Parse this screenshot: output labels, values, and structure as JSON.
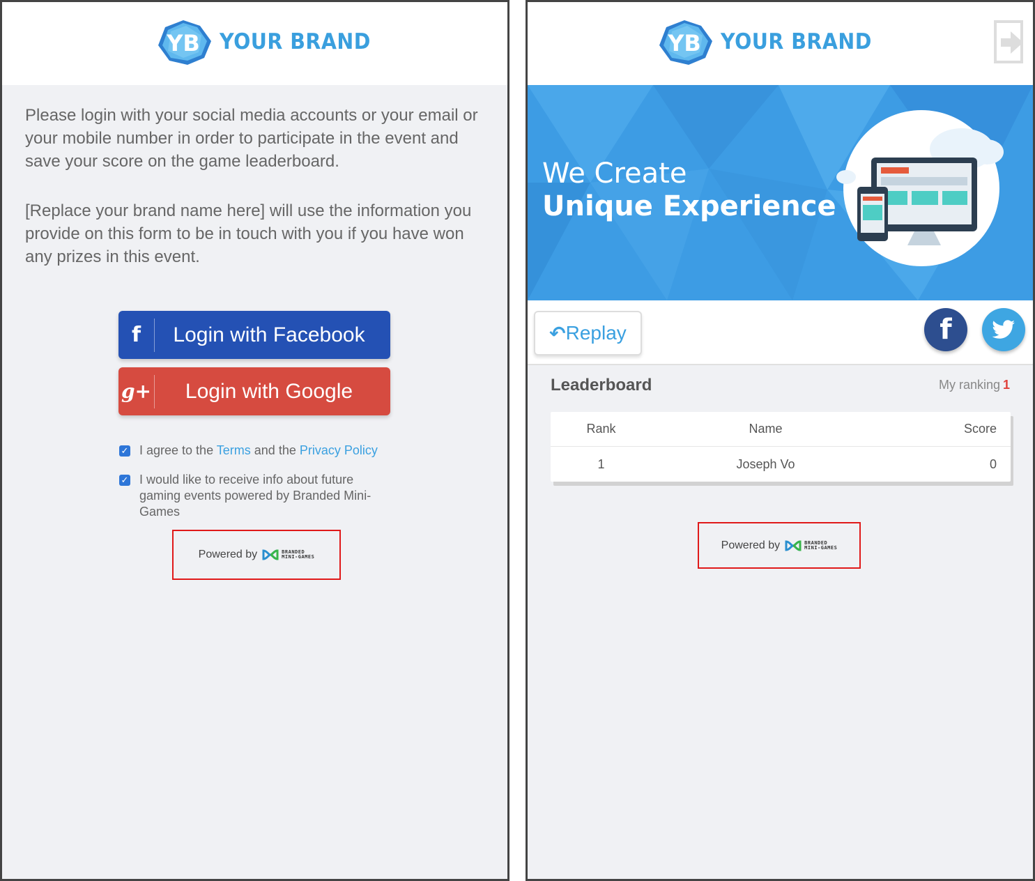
{
  "brand": {
    "initials": "YB",
    "name": "YOUR BRAND"
  },
  "login_screen": {
    "intro_paragraph_1": "Please login with your social media accounts or your email or your mobile number in order to participate in the event and save your score on the game leaderboard.",
    "intro_paragraph_2": "[Replace your brand name here] will use the information you provide on this form to be in touch with you if you have won any prizes in this event.",
    "facebook_button": {
      "icon": "f",
      "label": "Login with Facebook"
    },
    "google_button": {
      "icon": "g+",
      "label": "Login with Google"
    },
    "agree": {
      "checked": true,
      "prefix": "I agree to the",
      "terms_link": "Terms",
      "middle": "and the",
      "privacy_link": "Privacy Policy"
    },
    "info_optin": {
      "checked": true,
      "label": "I would like to receive info about future gaming events powered by Branded Mini-Games"
    },
    "powered_by": {
      "prefix": "Powered by",
      "logo_line1": "BRANDED",
      "logo_line2": "MINI-GAMES"
    }
  },
  "leaderboard_screen": {
    "banner": {
      "line1": "We Create",
      "line2": "Unique Experience"
    },
    "replay_label": "Replay",
    "title": "Leaderboard",
    "my_ranking_label": "My ranking",
    "my_ranking_value": "1",
    "table": {
      "columns": [
        "Rank",
        "Name",
        "Score"
      ],
      "rows": [
        {
          "rank": "1",
          "name": "Joseph Vo",
          "score": "0"
        }
      ]
    },
    "powered_by": {
      "prefix": "Powered by",
      "logo_line1": "BRANDED",
      "logo_line2": "MINI-GAMES"
    }
  },
  "colors": {
    "brand_blue": "#3a9fde",
    "facebook_blue": "#2451b4",
    "google_red": "#d64b40",
    "link_blue": "#3aa0e0",
    "ranking_red": "#e0413b",
    "highlight_red": "#e01919"
  },
  "icons": [
    "brand-logo-icon",
    "facebook-icon",
    "google-plus-icon",
    "checkbox-checked-icon",
    "branded-mini-games-logo-icon",
    "exit-icon",
    "replay-arrow-icon",
    "twitter-icon"
  ]
}
